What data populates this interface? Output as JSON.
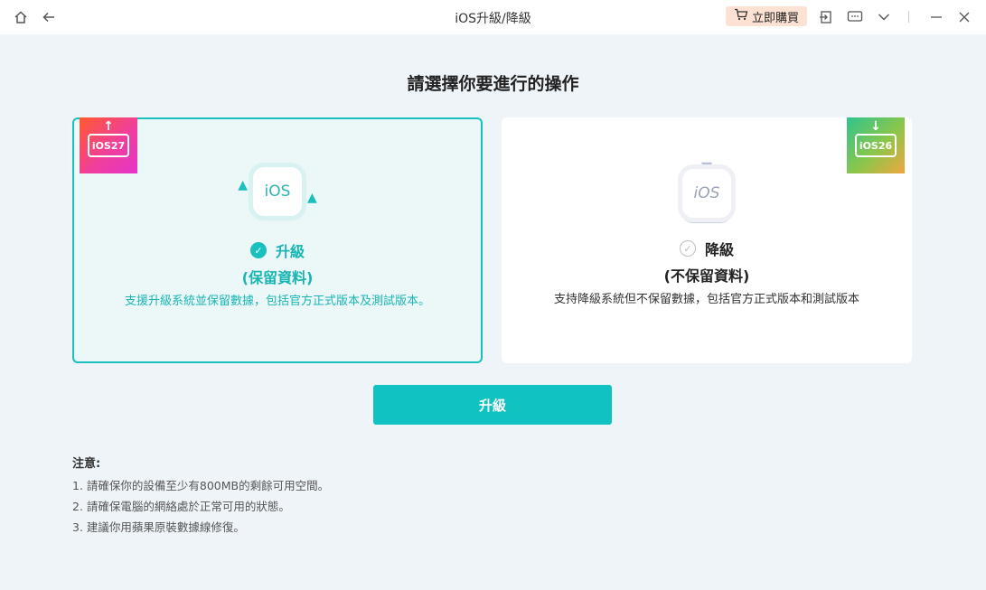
{
  "titlebar": {
    "title": "iOS升級/降級",
    "buy_label": "立即購買",
    "icons": [
      "home-icon",
      "back-icon",
      "cart-icon",
      "login-icon",
      "feedback-icon",
      "chevron-down-icon",
      "minimize-icon",
      "close-icon"
    ]
  },
  "heading": "請選擇你要進行的操作",
  "options": [
    {
      "badge": "iOS27",
      "tile_text": "iOS",
      "title": "升級",
      "subtitle": "(保留資料)",
      "description": "支援升級系統並保留數據，包括官方正式版本及測試版本。",
      "selected": true
    },
    {
      "badge": "iOS26",
      "tile_text": "iOS",
      "title": "降級",
      "subtitle": "(不保留資料)",
      "description": "支持降級系統但不保留數據，包括官方正式版本和測試版本",
      "selected": false
    }
  ],
  "primary_button": "升級",
  "notes": {
    "title": "注意:",
    "items": [
      "1.  請確保你的設備至少有800MB的剩餘可用空間。",
      "2.  請確保電腦的網絡處於正常可用的狀態。",
      "3.  建議你用蘋果原裝數據線修復。"
    ]
  },
  "colors": {
    "accent": "#10c2c1",
    "background": "#eff4f9"
  }
}
